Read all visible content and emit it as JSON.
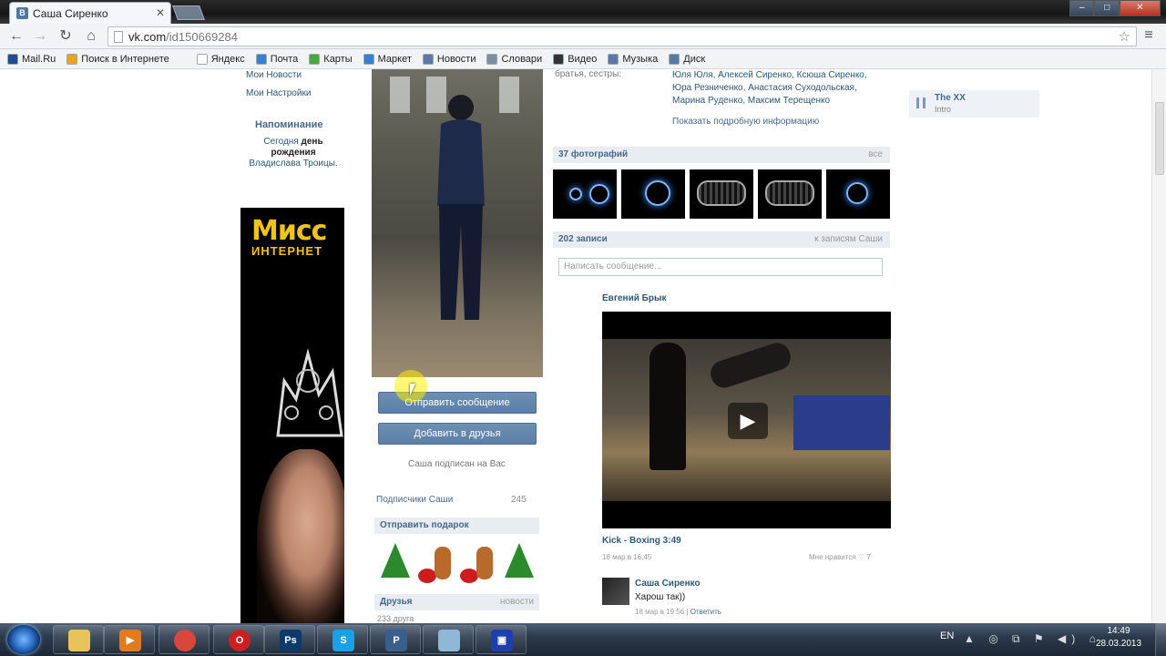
{
  "browser": {
    "tab_title": "Саша Сиренко",
    "tab_close": "✕",
    "url_host": "vk.com",
    "url_path": "/id150669284",
    "window_controls": {
      "min": "–",
      "max": "□",
      "close": "✕"
    }
  },
  "bookmarks": [
    {
      "label": "Mail.Ru",
      "color": "#1f4d91"
    },
    {
      "label": "Поиск в Интернете",
      "color": "#f2a01d"
    },
    {
      "label": "Яндекс",
      "color": "#ffffff"
    },
    {
      "label": "Почта",
      "color": "#3b7fd4"
    },
    {
      "label": "Карты",
      "color": "#49a83b"
    },
    {
      "label": "Маркет",
      "color": "#3b7fd4"
    },
    {
      "label": "Новости",
      "color": "#5b78a8"
    },
    {
      "label": "Словари",
      "color": "#7a8fa6"
    },
    {
      "label": "Видео",
      "color": "#333333"
    },
    {
      "label": "Музыка",
      "color": "#5b78a8"
    },
    {
      "label": "Диск",
      "color": "#5b78a8"
    }
  ],
  "leftnav": {
    "items": [
      "Мои Новости",
      "Мои Настройки"
    ],
    "reminder_title": "Напоминание",
    "reminder_today": "Сегодня",
    "reminder_birthday": "день рождения",
    "reminder_name": "Владислава Троицы."
  },
  "banner": {
    "line1": "Мисс",
    "line2": "ИНТЕРНЕТ"
  },
  "profile": {
    "send_message": "Отправить сообщение",
    "add_friend": "Добавить в друзья",
    "subscribed": "Саша подписан на Вас",
    "followers_label": "Подписчики Саши",
    "followers_count": "245",
    "gift_header": "Отправить подарок",
    "friends_header": "Друзья",
    "friends_right": "новости",
    "friends_count": "233 друга"
  },
  "info": {
    "relatives_label": "братья, сестры:",
    "relatives": "Юля Юля, Алексей Сиренко, Ксюша Сиренко, Юра Резниченко, Анастасия Суходольская, Марина Руденко, Максим Терещенко",
    "show_more": "Показать подробную информацию"
  },
  "photos": {
    "header": "37 фотографий",
    "right": "все"
  },
  "wall": {
    "header": "202 записи",
    "right": "к записям Саши",
    "placeholder": "Написать сообщение...",
    "post_author": "Евгений Брык",
    "video_title": "Kick - Boxing 3:49",
    "video_date": "18 мар в 16:45",
    "video_like": "Мне нравится ♡ 7",
    "play": "▶"
  },
  "comment": {
    "author": "Саша Сиренко",
    "text": "Харош так))",
    "meta": "18 мар в 19:56 |",
    "reply": "Ответить"
  },
  "audio": {
    "artist": "The XX",
    "track": "Intro"
  },
  "taskbar": {
    "lang": "EN",
    "tray": "▲ ◎ ⧉ ⚑ ◀) ⌂",
    "time": "14:49",
    "date": "28.03.2013",
    "apps": [
      {
        "name": "explorer",
        "label": "",
        "color": "#e7c35b"
      },
      {
        "name": "media-player",
        "label": "▶",
        "color": "#e07b1f"
      },
      {
        "name": "chrome",
        "label": "",
        "color": "#d9473b"
      },
      {
        "name": "opera",
        "label": "O",
        "color": "#cc1f1f"
      },
      {
        "name": "photoshop",
        "label": "Ps",
        "color": "#0c3a6b"
      },
      {
        "name": "skype",
        "label": "S",
        "color": "#1aa0e6"
      },
      {
        "name": "p-app",
        "label": "P",
        "color": "#3a5f8c"
      },
      {
        "name": "notes",
        "label": "",
        "color": "#8fb7d6"
      },
      {
        "name": "screen-recorder",
        "label": "▣",
        "color": "#1d3fb0"
      }
    ]
  }
}
